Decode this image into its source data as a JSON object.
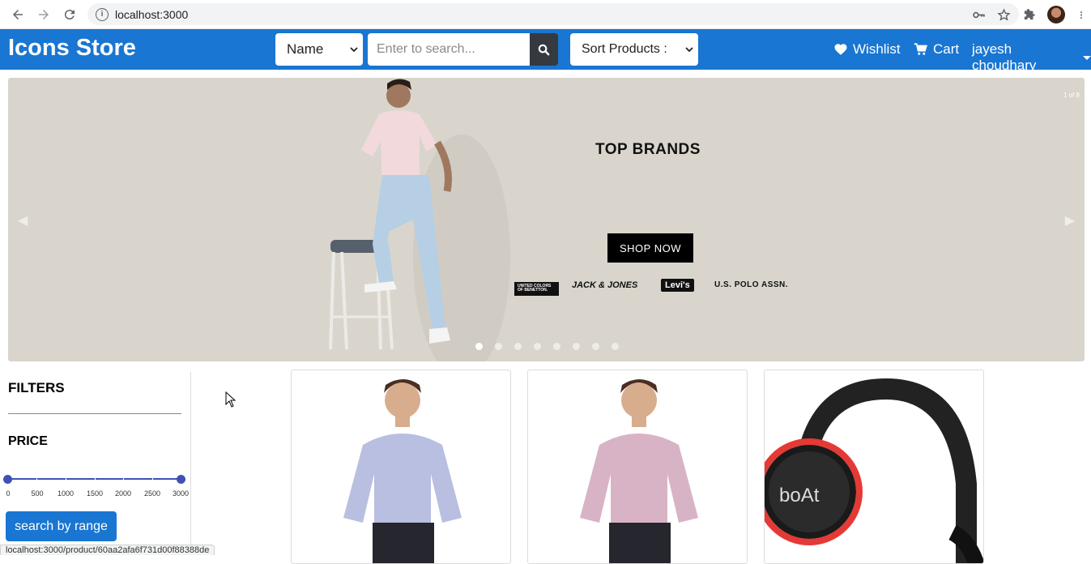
{
  "browser": {
    "url": "localhost:3000",
    "status_url": "localhost:3000/product/60aa2afa6f731d00f88388de"
  },
  "header": {
    "brand": "Icons Store",
    "search_by": "Name",
    "search_placeholder": "Enter to search...",
    "sort_label": "Sort Products :",
    "wishlist": "Wishlist",
    "cart": "Cart",
    "user": "jayesh choudhary"
  },
  "carousel": {
    "slide_counter": "1 of 8",
    "title": "TOP BRANDS",
    "button": "SHOP NOW",
    "brands": [
      "UNITED COLORS OF BENETTON.",
      "JACK & JONES",
      "Levi's",
      "U.S. POLO ASSN."
    ],
    "slide_count": 8,
    "active_slide": 1
  },
  "filters": {
    "title": "FILTERS",
    "price_title": "PRICE",
    "ticks": [
      "0",
      "500",
      "1000",
      "1500",
      "2000",
      "2500",
      "3000"
    ],
    "range_min": 0,
    "range_max": 3000,
    "button": "search by range"
  },
  "products": [
    {
      "name": "shirt-lavender",
      "color": "#b9bfe0"
    },
    {
      "name": "shirt-pink",
      "color": "#d8b3c6"
    },
    {
      "name": "boat-headphones",
      "logo": "boAt"
    }
  ],
  "colors": {
    "primary": "#1976d2",
    "slider": "#3f51b5",
    "banner_bg": "#d9d5cc"
  }
}
